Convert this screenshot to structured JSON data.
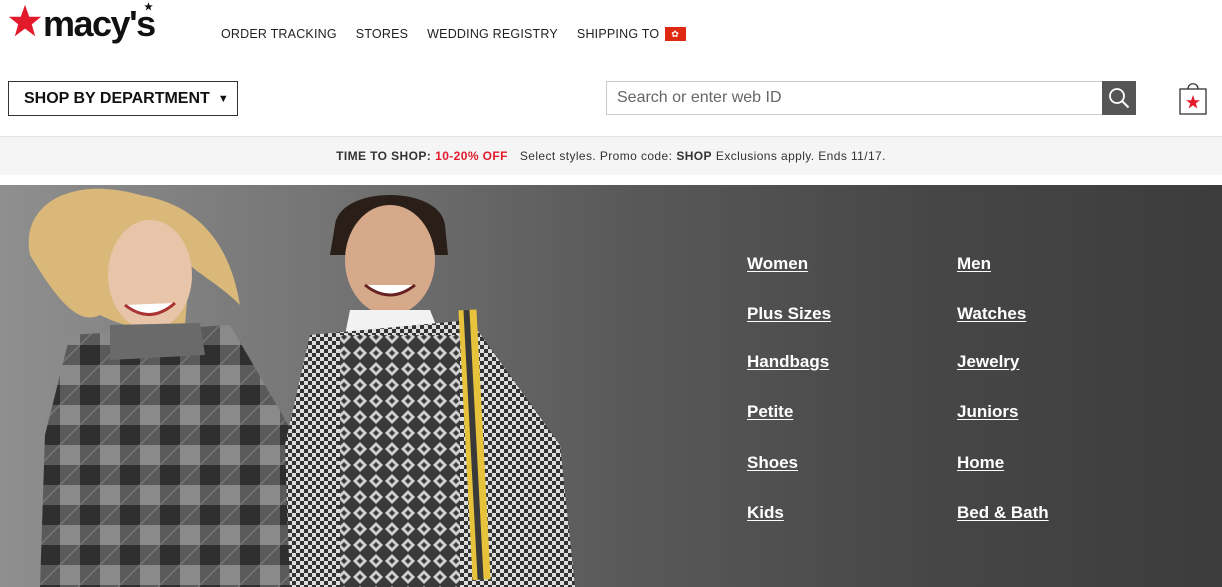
{
  "header": {
    "logo_text": "macy's",
    "nav": {
      "order_tracking": "ORDER TRACKING",
      "stores": "STORES",
      "wedding_registry": "WEDDING REGISTRY",
      "shipping_to": "SHIPPING TO"
    },
    "shop_by_department": "SHOP BY DEPARTMENT",
    "search": {
      "placeholder": "Search or enter web ID"
    }
  },
  "promo": {
    "label": "TIME TO SHOP:",
    "offer": "10-20% OFF",
    "select_styles": "Select styles. Promo code:",
    "code": "SHOP",
    "terms": "Exclusions apply. Ends 11/17."
  },
  "departments": {
    "left": [
      "Women",
      "Plus Sizes",
      "Handbags",
      "Petite",
      "Shoes",
      "Kids"
    ],
    "right": [
      "Men",
      "Watches",
      "Jewelry",
      "Juniors",
      "Home",
      "Bed & Bath"
    ]
  },
  "colors": {
    "brand_red": "#e21a2c",
    "flag_red": "#de2910",
    "search_button": "#555555"
  },
  "icons": [
    "macys-star-icon",
    "hong-kong-flag-icon",
    "caret-down-icon",
    "search-icon",
    "shopping-bag-icon"
  ]
}
